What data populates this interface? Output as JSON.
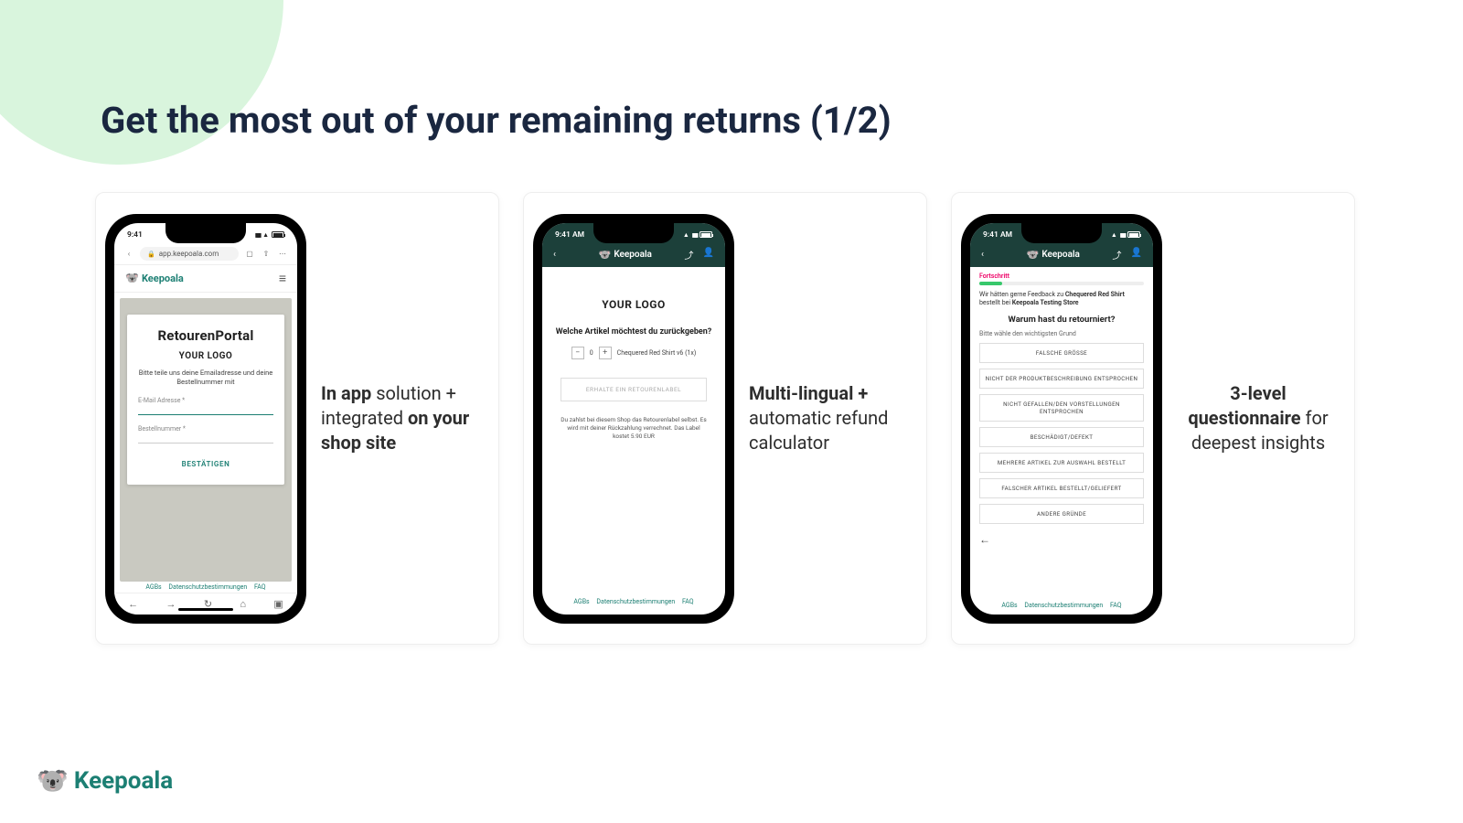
{
  "slide": {
    "title": "Get the most out of your remaining returns (1/2)"
  },
  "brand": {
    "name": "Keepoala"
  },
  "captions": {
    "c1_bold1": "In app",
    "c1_mid": " solution + integrated ",
    "c1_bold2": "on your shop site",
    "c2_bold": "Multi-lingual +",
    "c2_rest": " automatic refund calculator",
    "c3_bold": "3-level questionnaire",
    "c3_rest": " for deepest insights"
  },
  "phone1": {
    "time": "9:41",
    "url": "app.keepoala.com",
    "brand": "Keepoala",
    "portal_title": "RetourenPortal",
    "logo": "YOUR LOGO",
    "desc": "Bitte teile uns deine Emailadresse und deine Bestellnummer mit",
    "field_email": "E-Mail Adresse *",
    "field_order": "Bestellnummer *",
    "confirm": "BESTÄTIGEN",
    "footer": {
      "agb": "AGBs",
      "privacy": "Datenschutzbestimmungen",
      "faq": "FAQ"
    }
  },
  "phone2": {
    "time": "9:41 AM",
    "brand": "Keepoala",
    "logo": "YOUR LOGO",
    "question": "Welche Artikel möchtest du zurückgeben?",
    "item": "Chequered Red Shirt v6 (1x)",
    "qty": "0",
    "labelbtn": "ERHALTE EIN RETOURENLABEL",
    "small": "Du zahlst bei diesem Shop das Retourenlabel selbst. Es wird mit deiner Rückzahlung verrechnet. Das Label kostet 5.90 EUR",
    "footer": {
      "agb": "AGBs",
      "privacy": "Datenschutzbestimmungen",
      "faq": "FAQ"
    }
  },
  "phone3": {
    "time": "9:41 AM",
    "brand": "Keepoala",
    "progress_label": "Fortschritt",
    "feedback_pre": "Wir hätten gerne Feedback zu ",
    "feedback_item": "Chequered Red Shirt",
    "feedback_mid": " bestellt bei ",
    "feedback_store": "Keepoala Testing Store",
    "question": "Warum hast du retourniert?",
    "sub": "Bitte wähle den wichtigsten Grund",
    "options": [
      "FALSCHE GRÖSSE",
      "NICHT DER PRODUKTBESCHREIBUNG ENTSPROCHEN",
      "NICHT GEFALLEN/DEN VORSTELLUNGEN ENTSPROCHEN",
      "BESCHÄDIGT/DEFEKT",
      "MEHRERE ARTIKEL ZUR AUSWAHL BESTELLT",
      "FALSCHER ARTIKEL BESTELLT/GELIEFERT",
      "ANDERE GRÜNDE"
    ],
    "footer": {
      "agb": "AGBs",
      "privacy": "Datenschutzbestimmungen",
      "faq": "FAQ"
    }
  }
}
